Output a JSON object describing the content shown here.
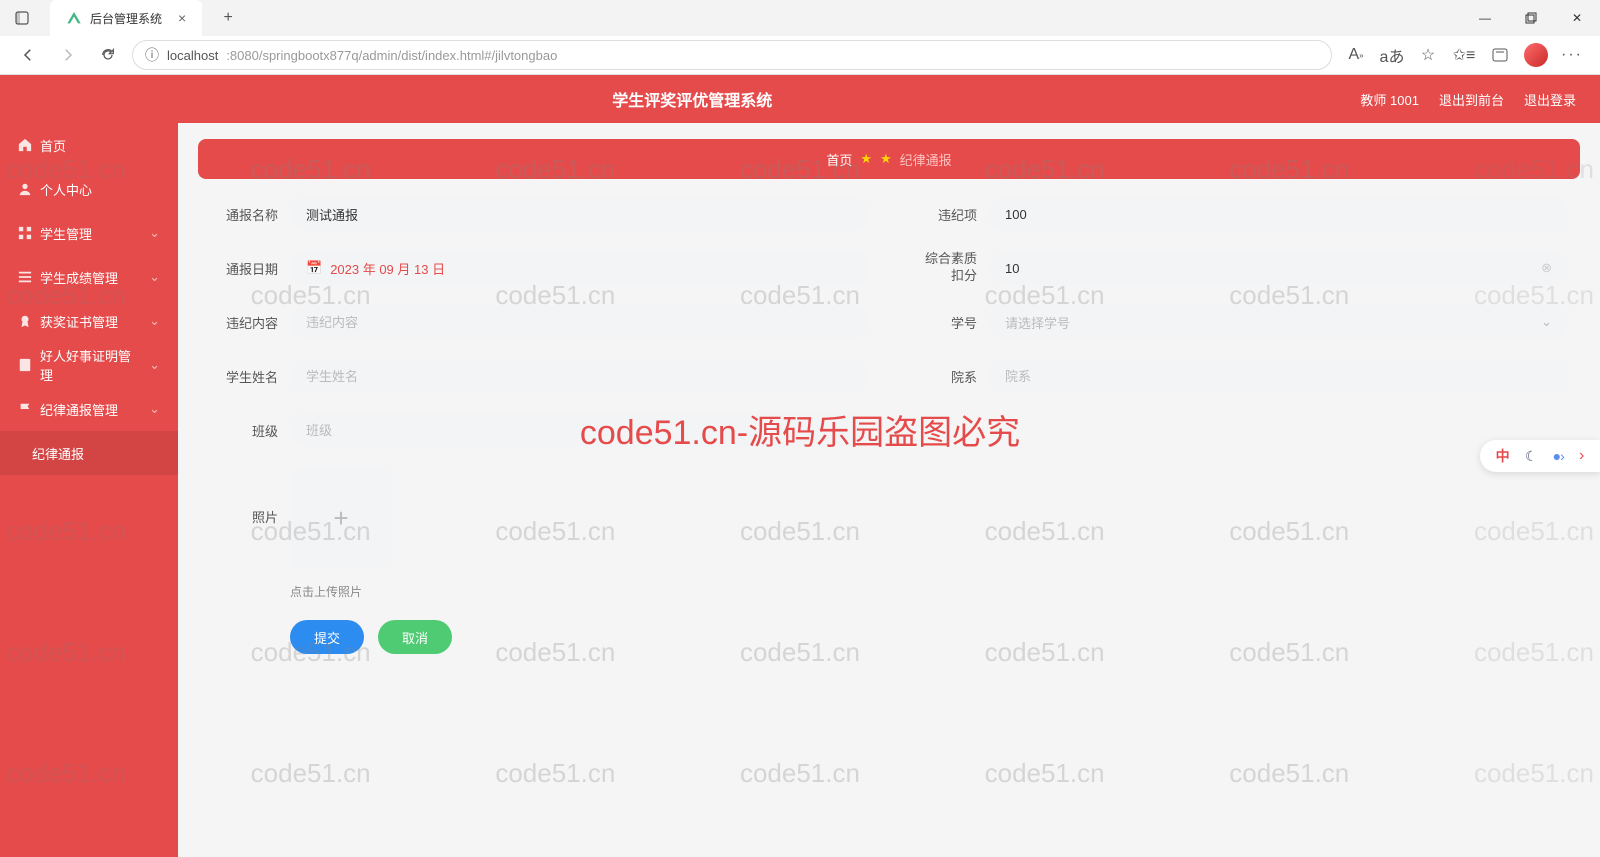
{
  "browser": {
    "tab_title": "后台管理系统",
    "url_host": "localhost",
    "url_path": ":8080/springbootx877q/admin/dist/index.html#/jilvtongbao"
  },
  "header": {
    "app_title": "学生评奖评优管理系统",
    "user": "教师 1001",
    "to_front": "退出到前台",
    "logout": "退出登录"
  },
  "sidebar": {
    "items": [
      {
        "label": "首页"
      },
      {
        "label": "个人中心"
      },
      {
        "label": "学生管理"
      },
      {
        "label": "学生成绩管理"
      },
      {
        "label": "获奖证书管理"
      },
      {
        "label": "好人好事证明管理"
      },
      {
        "label": "纪律通报管理"
      },
      {
        "label": "纪律通报"
      }
    ]
  },
  "breadcrumb": {
    "home": "首页",
    "current": "纪律通报"
  },
  "form": {
    "name_label": "通报名称",
    "name_value": "测试通报",
    "violation_label": "违纪项",
    "violation_value": "100",
    "date_label": "通报日期",
    "date_value": "2023 年 09 月 13 日",
    "quality_label1": "综合素质",
    "quality_label2": "扣分",
    "quality_value": "10",
    "content_label": "违纪内容",
    "content_placeholder": "违纪内容",
    "studentno_label": "学号",
    "studentno_placeholder": "请选择学号",
    "studentname_label": "学生姓名",
    "studentname_placeholder": "学生姓名",
    "dept_label": "院系",
    "dept_placeholder": "院系",
    "class_label": "班级",
    "class_placeholder": "班级",
    "photo_label": "照片",
    "photo_hint": "点击上传照片",
    "submit": "提交",
    "cancel": "取消"
  },
  "watermark": {
    "text": "code51.cn",
    "center": "code51.cn-源码乐园盗图必究"
  },
  "float": {
    "lang": "中"
  }
}
